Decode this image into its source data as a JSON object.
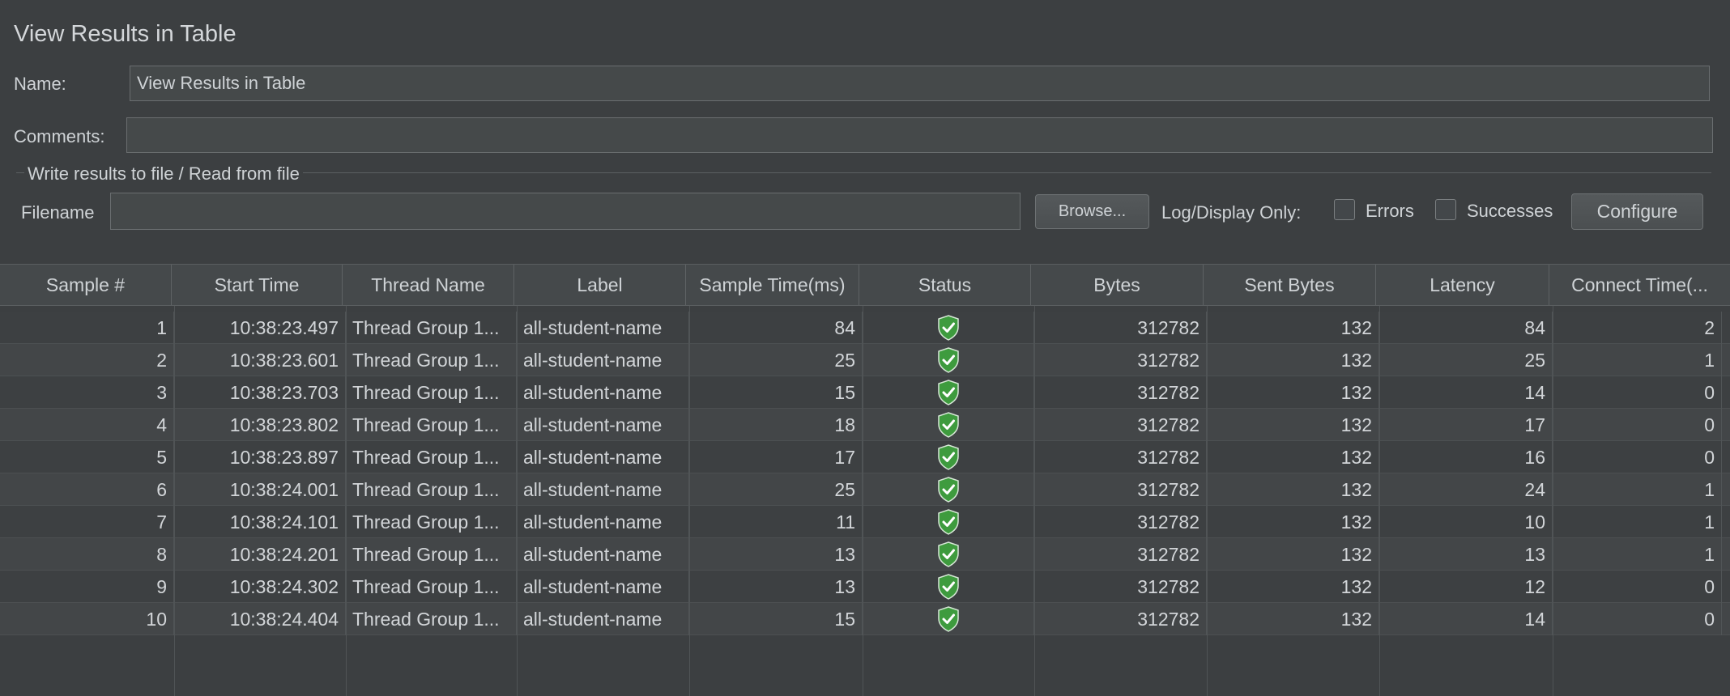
{
  "panel": {
    "title": "View Results in Table",
    "name_label": "Name:",
    "name_value": "View Results in Table",
    "comments_label": "Comments:",
    "comments_value": ""
  },
  "file_group": {
    "title": "Write results to file / Read from file",
    "filename_label": "Filename",
    "filename_value": "",
    "browse_label": "Browse...",
    "log_display_label": "Log/Display Only:",
    "errors_label": "Errors",
    "errors_checked": false,
    "successes_label": "Successes",
    "successes_checked": false,
    "configure_label": "Configure"
  },
  "table": {
    "columns": [
      "Sample #",
      "Start Time",
      "Thread Name",
      "Label",
      "Sample Time(ms)",
      "Status",
      "Bytes",
      "Sent Bytes",
      "Latency",
      "Connect Time(..."
    ],
    "rows": [
      {
        "sample": "1",
        "start": "10:38:23.497",
        "thread": "Thread Group 1...",
        "label": "all-student-name",
        "time": "84",
        "status": "success-shield-icon",
        "bytes": "312782",
        "sent": "132",
        "latency": "84",
        "connect": "2"
      },
      {
        "sample": "2",
        "start": "10:38:23.601",
        "thread": "Thread Group 1...",
        "label": "all-student-name",
        "time": "25",
        "status": "success-shield-icon",
        "bytes": "312782",
        "sent": "132",
        "latency": "25",
        "connect": "1"
      },
      {
        "sample": "3",
        "start": "10:38:23.703",
        "thread": "Thread Group 1...",
        "label": "all-student-name",
        "time": "15",
        "status": "success-shield-icon",
        "bytes": "312782",
        "sent": "132",
        "latency": "14",
        "connect": "0"
      },
      {
        "sample": "4",
        "start": "10:38:23.802",
        "thread": "Thread Group 1...",
        "label": "all-student-name",
        "time": "18",
        "status": "success-shield-icon",
        "bytes": "312782",
        "sent": "132",
        "latency": "17",
        "connect": "0"
      },
      {
        "sample": "5",
        "start": "10:38:23.897",
        "thread": "Thread Group 1...",
        "label": "all-student-name",
        "time": "17",
        "status": "success-shield-icon",
        "bytes": "312782",
        "sent": "132",
        "latency": "16",
        "connect": "0"
      },
      {
        "sample": "6",
        "start": "10:38:24.001",
        "thread": "Thread Group 1...",
        "label": "all-student-name",
        "time": "25",
        "status": "success-shield-icon",
        "bytes": "312782",
        "sent": "132",
        "latency": "24",
        "connect": "1"
      },
      {
        "sample": "7",
        "start": "10:38:24.101",
        "thread": "Thread Group 1...",
        "label": "all-student-name",
        "time": "11",
        "status": "success-shield-icon",
        "bytes": "312782",
        "sent": "132",
        "latency": "10",
        "connect": "1"
      },
      {
        "sample": "8",
        "start": "10:38:24.201",
        "thread": "Thread Group 1...",
        "label": "all-student-name",
        "time": "13",
        "status": "success-shield-icon",
        "bytes": "312782",
        "sent": "132",
        "latency": "13",
        "connect": "1"
      },
      {
        "sample": "9",
        "start": "10:38:24.302",
        "thread": "Thread Group 1...",
        "label": "all-student-name",
        "time": "13",
        "status": "success-shield-icon",
        "bytes": "312782",
        "sent": "132",
        "latency": "12",
        "connect": "0"
      },
      {
        "sample": "10",
        "start": "10:38:24.404",
        "thread": "Thread Group 1...",
        "label": "all-student-name",
        "time": "15",
        "status": "success-shield-icon",
        "bytes": "312782",
        "sent": "132",
        "latency": "14",
        "connect": "0"
      }
    ]
  },
  "colors": {
    "background": "#3c3f41",
    "success_green": "#4caf50"
  }
}
